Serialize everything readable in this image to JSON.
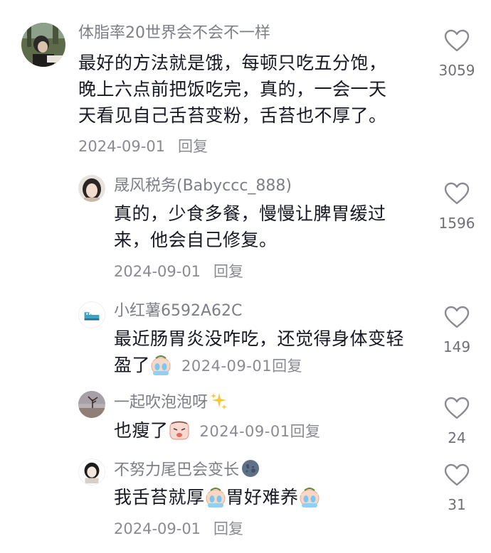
{
  "comments": [
    {
      "username": "体脂率20世界会不会不一样",
      "lines": [
        "最好的方法就是饿，每顿只吃五分饱，",
        "晚上六点前把饭吃完，真的，一会一天",
        "天看见自己舌苔变粉，舌苔也不厚了。"
      ],
      "date": "2024-09-01",
      "reply": "回复",
      "likes": "3059"
    },
    {
      "username": "晟风税务(Babyccc_888)",
      "lines": [
        "真的，少食多餐，慢慢让脾胃缓过",
        "来，他会自己修复。"
      ],
      "date": "2024-09-01",
      "reply": "回复",
      "likes": "1596"
    },
    {
      "username": "小红薯6592A62C",
      "line1": "最近肠胃炎没咋吃，还觉得身体变轻",
      "line2": "盈了",
      "emoji": "crying-face-emoji",
      "date": "2024-09-01",
      "reply": "回复",
      "likes": "149"
    },
    {
      "username": "一起吹泡泡呀",
      "username_icon": "sparkles-icon",
      "text": "也瘦了",
      "emoji": "sad-face-emoji",
      "date": "2024-09-01",
      "reply": "回复",
      "likes": "24"
    },
    {
      "username": "不努力尾巴会变长",
      "username_icon": "moon-face-icon",
      "text_a": "我舌苔就厚",
      "text_b": "胃好难养",
      "emoji": "crying-face-emoji",
      "date": "2024-09-01",
      "reply": "回复",
      "likes": "31"
    }
  ],
  "colors": {
    "text": "#161823",
    "secondary": "#8a8b91",
    "heart": "#8a8b91"
  }
}
